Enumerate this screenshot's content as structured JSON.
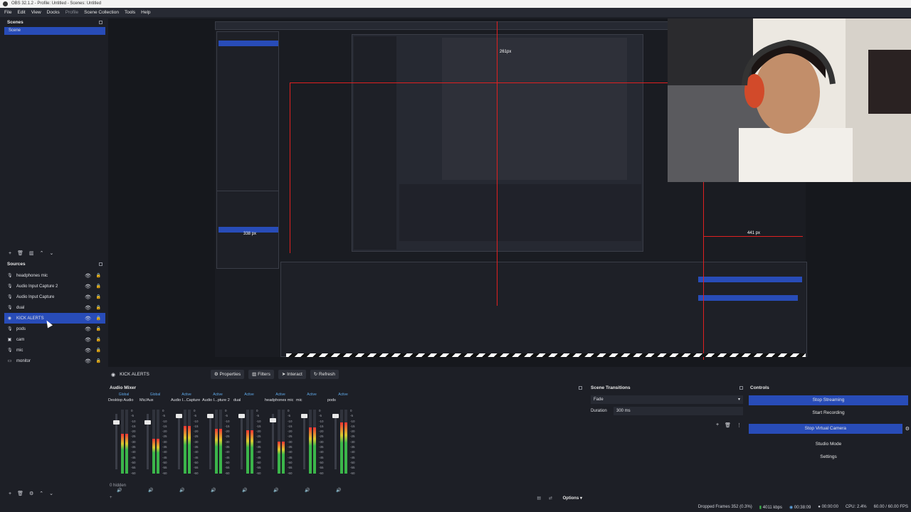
{
  "window": {
    "title": "OBS 32.1.2 - Profile: Untitled - Scenes: Untitled"
  },
  "menu": [
    "File",
    "Edit",
    "View",
    "Docks",
    "Profile",
    "Scene Collection",
    "Tools",
    "Help"
  ],
  "scenes": {
    "title": "Scenes",
    "items": [
      {
        "label": "Scene",
        "selected": true
      }
    ]
  },
  "sources": {
    "title": "Sources",
    "items": [
      {
        "label": "headphones mic",
        "icon": "mic-icon"
      },
      {
        "label": "Audio Input Capture 2",
        "icon": "mic-icon"
      },
      {
        "label": "Audio Input Capture",
        "icon": "mic-icon"
      },
      {
        "label": "dual",
        "icon": "mic-icon"
      },
      {
        "label": "KICK ALERTS",
        "icon": "browser-icon",
        "selected": true
      },
      {
        "label": "pods",
        "icon": "mic-icon"
      },
      {
        "label": "cam",
        "icon": "camera-icon"
      },
      {
        "label": "mic",
        "icon": "mic-icon"
      },
      {
        "label": "monitor",
        "icon": "display-icon"
      }
    ]
  },
  "preview": {
    "label_a": "441 px",
    "label_b": "261px",
    "label_c": "338 px"
  },
  "source_toolbar": {
    "selected_source": "KICK ALERTS",
    "properties": "Properties",
    "filters": "Filters",
    "interact": "Interact",
    "refresh": "Refresh"
  },
  "audio_mixer": {
    "title": "Audio Mixer",
    "channels": [
      {
        "name": "Desktop Audio",
        "status": "Global",
        "level": 0.62,
        "fader": 0.12
      },
      {
        "name": "Mic/Aux",
        "status": "Global",
        "level": 0.55,
        "fader": 0.12
      },
      {
        "name": "Audio I...Capture",
        "status": "Active",
        "level": 0.75,
        "fader": 0.0
      },
      {
        "name": "Audio I...pture 2",
        "status": "Active",
        "level": 0.7,
        "fader": 0.0
      },
      {
        "name": "dual",
        "status": "Active",
        "level": 0.68,
        "fader": 0.0
      },
      {
        "name": "headphones mic",
        "status": "Active",
        "level": 0.5,
        "fader": 0.08
      },
      {
        "name": "mic",
        "status": "Active",
        "level": 0.72,
        "fader": 0.0
      },
      {
        "name": "pods",
        "status": "Active",
        "level": 0.8,
        "fader": 0.0
      }
    ],
    "scale": [
      "0",
      "-5",
      "-10",
      "-15",
      "-20",
      "-25",
      "-30",
      "-35",
      "-40",
      "-45",
      "-50",
      "-55",
      "-60"
    ],
    "hidden": "0 hidden",
    "options": "Options"
  },
  "scene_transitions": {
    "title": "Scene Transitions",
    "transition": "Fade",
    "duration_label": "Duration",
    "duration_value": "300 ms"
  },
  "controls": {
    "title": "Controls",
    "buttons": [
      {
        "label": "Stop Streaming",
        "active": true
      },
      {
        "label": "Start Recording",
        "active": false
      },
      {
        "label": "Stop Virtual Camera",
        "active": true
      },
      {
        "label": "Studio Mode",
        "active": false
      },
      {
        "label": "Settings",
        "active": false
      }
    ]
  },
  "statusbar": {
    "dropped": "Dropped Frames 352 (0.3%)",
    "bitrate": "4011 kbps",
    "stream_time": "00:38:09",
    "rec_time": "00:00:00",
    "cpu": "CPU: 2.4%",
    "fps": "60.00 / 60.00 FPS"
  }
}
